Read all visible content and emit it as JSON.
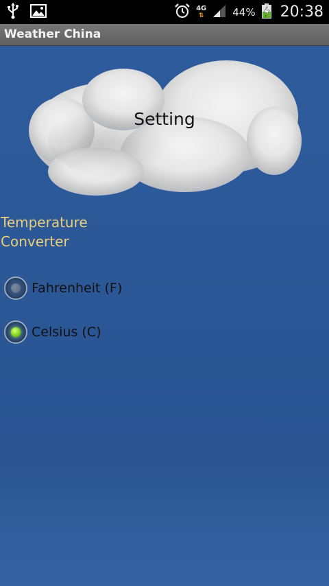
{
  "status_bar": {
    "icons_left": [
      "usb-icon",
      "image-icon"
    ],
    "icons_right": [
      "alarm-icon",
      "network-4g-icon",
      "signal-icon",
      "battery-charging-icon"
    ],
    "network_type": "4G",
    "battery_percent": "44%",
    "time": "20:38"
  },
  "app": {
    "title": "Weather China"
  },
  "screen": {
    "heading": "Setting",
    "section_title": "Temperature Converter",
    "options": [
      {
        "label": "Fahrenheit (F)",
        "checked": false
      },
      {
        "label": "Celsius (C)",
        "checked": true
      }
    ]
  },
  "colors": {
    "background": "#2c5897",
    "title_bar": "#666666",
    "section_title": "#e9cf7a",
    "radio_checked": "#7dd31a"
  }
}
